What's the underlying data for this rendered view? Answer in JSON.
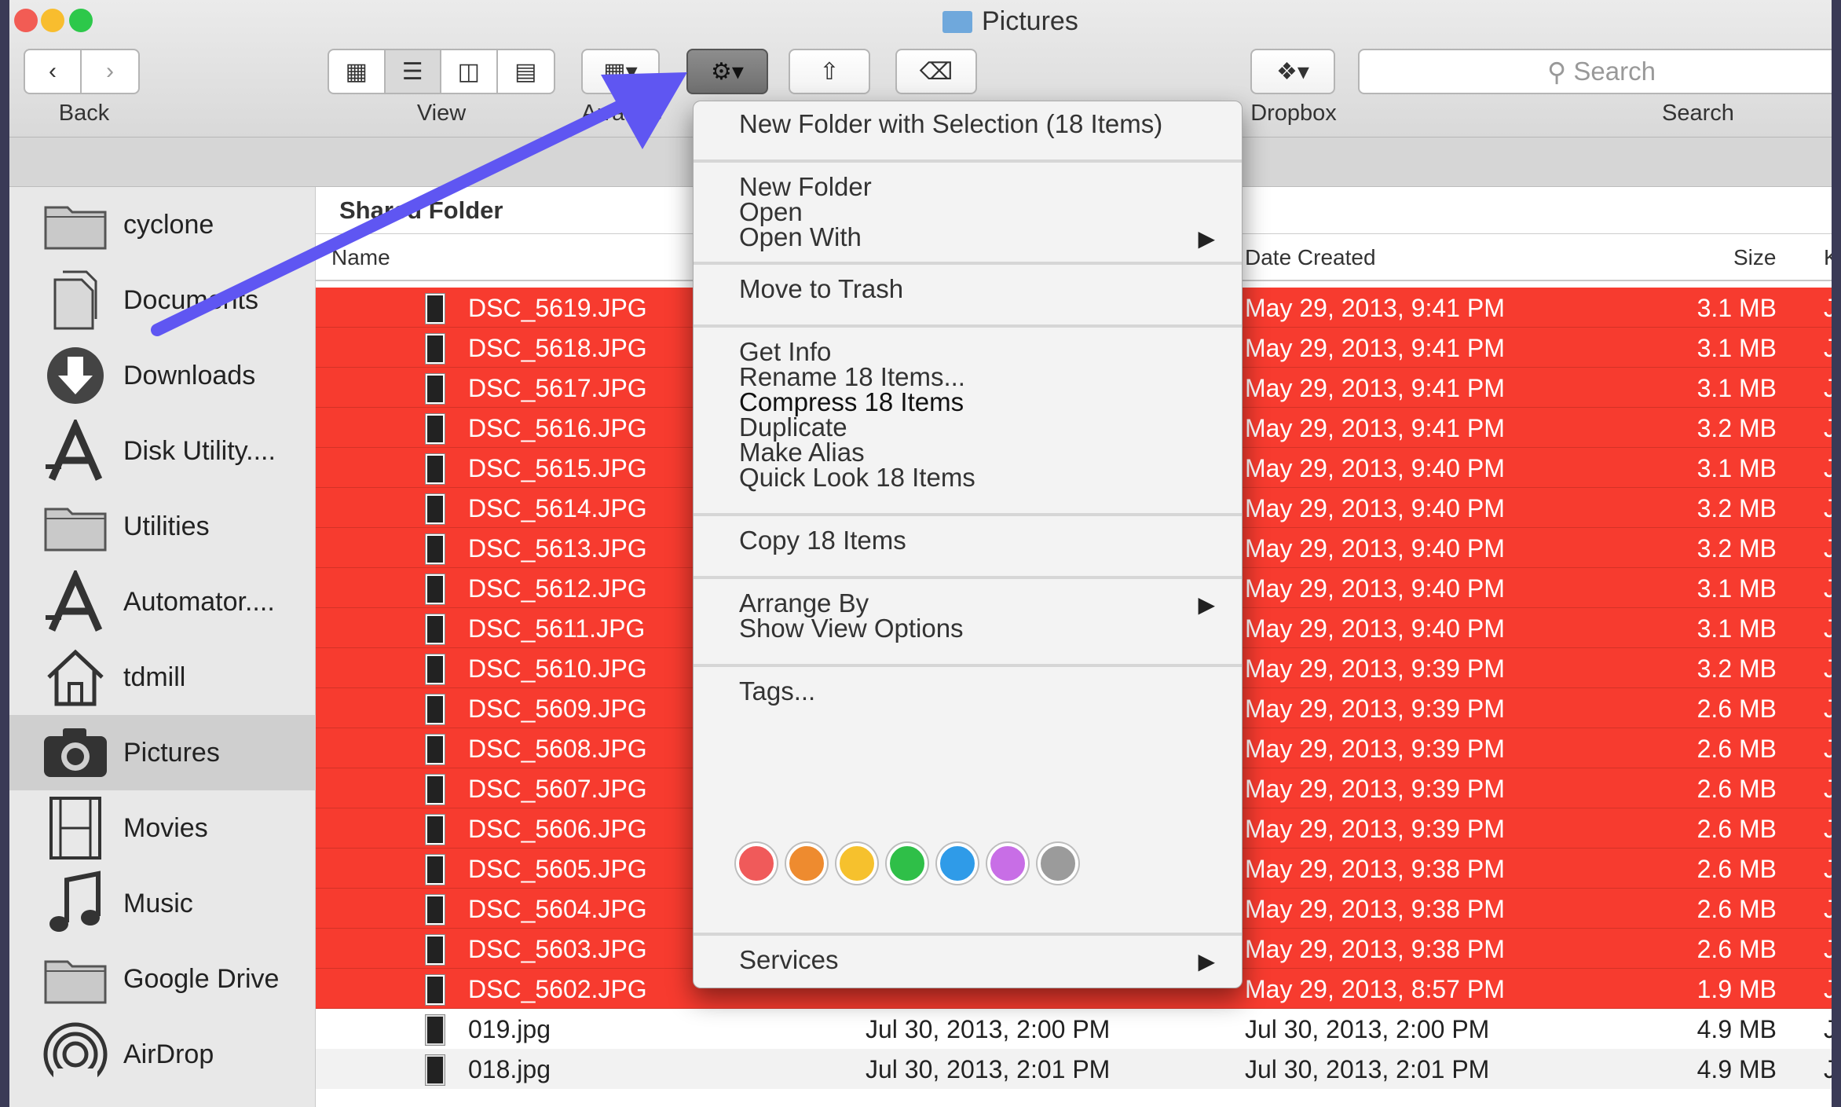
{
  "window": {
    "title": "Pictures"
  },
  "toolbar": {
    "back_label": "Back",
    "view_label": "View",
    "arrange_label": "Arrange",
    "dropbox_label": "Dropbox",
    "search_label": "Search",
    "search_placeholder": "Search"
  },
  "sidebar": {
    "items": [
      {
        "label": "cyclone",
        "icon": "folder-icon"
      },
      {
        "label": "Documents",
        "icon": "documents-icon"
      },
      {
        "label": "Downloads",
        "icon": "downloads-icon"
      },
      {
        "label": "Disk Utility....",
        "icon": "app-icon"
      },
      {
        "label": "Utilities",
        "icon": "folder-icon"
      },
      {
        "label": "Automator....",
        "icon": "app-icon"
      },
      {
        "label": "tdmill",
        "icon": "home-icon"
      },
      {
        "label": "Pictures",
        "icon": "camera-icon"
      },
      {
        "label": "Movies",
        "icon": "film-icon"
      },
      {
        "label": "Music",
        "icon": "music-icon"
      },
      {
        "label": "Google Drive",
        "icon": "folder-icon"
      },
      {
        "label": "AirDrop",
        "icon": "airdrop-icon"
      }
    ]
  },
  "content": {
    "group_header": "Shared Folder",
    "columns": {
      "name": "Name",
      "date_created": "Date Created",
      "size": "Size",
      "kind": "K"
    },
    "files": [
      {
        "name": "DSC_5619.JPG",
        "date_created": "May 29, 2013, 9:41 PM",
        "size": "3.1 MB",
        "kind": "J",
        "selected": true
      },
      {
        "name": "DSC_5618.JPG",
        "date_created": "May 29, 2013, 9:41 PM",
        "size": "3.1 MB",
        "kind": "J",
        "selected": true
      },
      {
        "name": "DSC_5617.JPG",
        "date_created": "May 29, 2013, 9:41 PM",
        "size": "3.1 MB",
        "kind": "J",
        "selected": true
      },
      {
        "name": "DSC_5616.JPG",
        "date_created": "May 29, 2013, 9:41 PM",
        "size": "3.2 MB",
        "kind": "J",
        "selected": true
      },
      {
        "name": "DSC_5615.JPG",
        "date_created": "May 29, 2013, 9:40 PM",
        "size": "3.1 MB",
        "kind": "J",
        "selected": true
      },
      {
        "name": "DSC_5614.JPG",
        "date_created": "May 29, 2013, 9:40 PM",
        "size": "3.2 MB",
        "kind": "J",
        "selected": true
      },
      {
        "name": "DSC_5613.JPG",
        "date_created": "May 29, 2013, 9:40 PM",
        "size": "3.2 MB",
        "kind": "J",
        "selected": true
      },
      {
        "name": "DSC_5612.JPG",
        "date_created": "May 29, 2013, 9:40 PM",
        "size": "3.1 MB",
        "kind": "J",
        "selected": true
      },
      {
        "name": "DSC_5611.JPG",
        "date_created": "May 29, 2013, 9:40 PM",
        "size": "3.1 MB",
        "kind": "J",
        "selected": true
      },
      {
        "name": "DSC_5610.JPG",
        "date_created": "May 29, 2013, 9:39 PM",
        "size": "3.2 MB",
        "kind": "J",
        "selected": true
      },
      {
        "name": "DSC_5609.JPG",
        "date_created": "May 29, 2013, 9:39 PM",
        "size": "2.6 MB",
        "kind": "J",
        "selected": true
      },
      {
        "name": "DSC_5608.JPG",
        "date_created": "May 29, 2013, 9:39 PM",
        "size": "2.6 MB",
        "kind": "J",
        "selected": true
      },
      {
        "name": "DSC_5607.JPG",
        "date_created": "May 29, 2013, 9:39 PM",
        "size": "2.6 MB",
        "kind": "J",
        "selected": true
      },
      {
        "name": "DSC_5606.JPG",
        "date_created": "May 29, 2013, 9:39 PM",
        "size": "2.6 MB",
        "kind": "J",
        "selected": true
      },
      {
        "name": "DSC_5605.JPG",
        "date_created": "May 29, 2013, 9:38 PM",
        "size": "2.6 MB",
        "kind": "J",
        "selected": true
      },
      {
        "name": "DSC_5604.JPG",
        "date_created": "May 29, 2013, 9:38 PM",
        "size": "2.6 MB",
        "kind": "J",
        "selected": true
      },
      {
        "name": "DSC_5603.JPG",
        "date_created": "May 29, 2013, 9:38 PM",
        "size": "2.6 MB",
        "kind": "J",
        "selected": true
      },
      {
        "name": "DSC_5602.JPG",
        "date_created": "May 29, 2013, 8:57 PM",
        "size": "1.9 MB",
        "kind": "J",
        "selected": true
      },
      {
        "name": "019.jpg",
        "date_modified": "Jul 30, 2013, 2:00 PM",
        "date_created": "Jul 30, 2013, 2:00 PM",
        "size": "4.9 MB",
        "kind": "J",
        "selected": false
      },
      {
        "name": "018.jpg",
        "date_modified": "Jul 30, 2013, 2:01 PM",
        "date_created": "Jul 30, 2013, 2:01 PM",
        "size": "4.9 MB",
        "kind": "J",
        "selected": false
      }
    ]
  },
  "context_menu": {
    "new_folder_with_selection": "New Folder with Selection (18 Items)",
    "new_folder": "New Folder",
    "open": "Open",
    "open_with": "Open With",
    "move_to_trash": "Move to Trash",
    "get_info": "Get Info",
    "rename": "Rename 18 Items...",
    "compress": "Compress 18 Items",
    "duplicate": "Duplicate",
    "make_alias": "Make Alias",
    "quick_look": "Quick Look 18 Items",
    "copy": "Copy 18 Items",
    "arrange_by": "Arrange By",
    "show_view_options": "Show View Options",
    "tags": "Tags...",
    "services": "Services",
    "tag_colors": [
      "#f05a5a",
      "#ee8b2f",
      "#f6c12d",
      "#2fbf48",
      "#2f9be8",
      "#c86ee6",
      "#9b9b9b"
    ]
  },
  "colors": {
    "selection": "#f73b2f",
    "annotation_arrow": "#5f56f2"
  }
}
